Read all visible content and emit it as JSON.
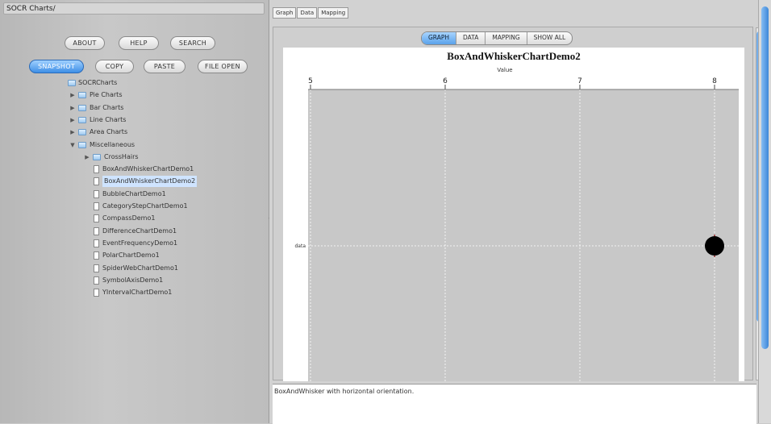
{
  "window": {
    "left_title": "SOCR Charts/"
  },
  "buttons_row1": [
    "ABOUT",
    "HELP",
    "SEARCH"
  ],
  "buttons_row2": [
    {
      "label": "SNAPSHOT",
      "selected": true
    },
    {
      "label": "COPY",
      "selected": false
    },
    {
      "label": "PASTE",
      "selected": false
    },
    {
      "label": "FILE OPEN",
      "selected": false
    }
  ],
  "tree": [
    {
      "label": "SOCRCharts",
      "level": 0,
      "kind": "root",
      "expanded": true
    },
    {
      "label": "Pie Charts",
      "level": 1,
      "kind": "folder",
      "expanded": false
    },
    {
      "label": "Bar Charts",
      "level": 1,
      "kind": "folder",
      "expanded": false
    },
    {
      "label": "Line Charts",
      "level": 1,
      "kind": "folder",
      "expanded": false
    },
    {
      "label": "Area Charts",
      "level": 1,
      "kind": "folder",
      "expanded": false
    },
    {
      "label": "Miscellaneous",
      "level": 1,
      "kind": "folder",
      "expanded": true
    },
    {
      "label": "CrossHairs",
      "level": 2,
      "kind": "folder",
      "expanded": false
    },
    {
      "label": "BoxAndWhiskerChartDemo1",
      "level": 2,
      "kind": "doc"
    },
    {
      "label": "BoxAndWhiskerChartDemo2",
      "level": 2,
      "kind": "doc",
      "selected": true
    },
    {
      "label": "BubbleChartDemo1",
      "level": 2,
      "kind": "doc"
    },
    {
      "label": "CategoryStepChartDemo1",
      "level": 2,
      "kind": "doc"
    },
    {
      "label": "CompassDemo1",
      "level": 2,
      "kind": "doc"
    },
    {
      "label": "DifferenceChartDemo1",
      "level": 2,
      "kind": "doc"
    },
    {
      "label": "EventFrequencyDemo1",
      "level": 2,
      "kind": "doc"
    },
    {
      "label": "PolarChartDemo1",
      "level": 2,
      "kind": "doc"
    },
    {
      "label": "SpiderWebChartDemo1",
      "level": 2,
      "kind": "doc"
    },
    {
      "label": "SymbolAxisDemo1",
      "level": 2,
      "kind": "doc"
    },
    {
      "label": "YIntervalChartDemo1",
      "level": 2,
      "kind": "doc"
    }
  ],
  "top_tabs": [
    "Graph",
    "Data",
    "Mapping"
  ],
  "view_tabs": [
    {
      "label": "GRAPH",
      "active": true
    },
    {
      "label": "DATA",
      "active": false
    },
    {
      "label": "MAPPING",
      "active": false
    },
    {
      "label": "SHOW ALL",
      "active": false
    }
  ],
  "bottom_text": "BoxAndWhisker with horizontal orientation.",
  "colors": {
    "selected": "#3e8fe6",
    "plot_bg": "#c8c8c8",
    "marker": "#000000",
    "whisker": "#8b0000"
  },
  "chart_data": {
    "type": "box",
    "title": "BoxAndWhiskerChartDemo2",
    "xlabel": "Value",
    "ylabel": "",
    "orientation": "horizontal",
    "axis_position": "top",
    "x_ticks": [
      5,
      6,
      7,
      8
    ],
    "xlim": [
      5,
      8
    ],
    "categories": [
      "data"
    ],
    "series": [
      {
        "name": "data",
        "values": [
          8
        ]
      }
    ],
    "grid": true
  }
}
